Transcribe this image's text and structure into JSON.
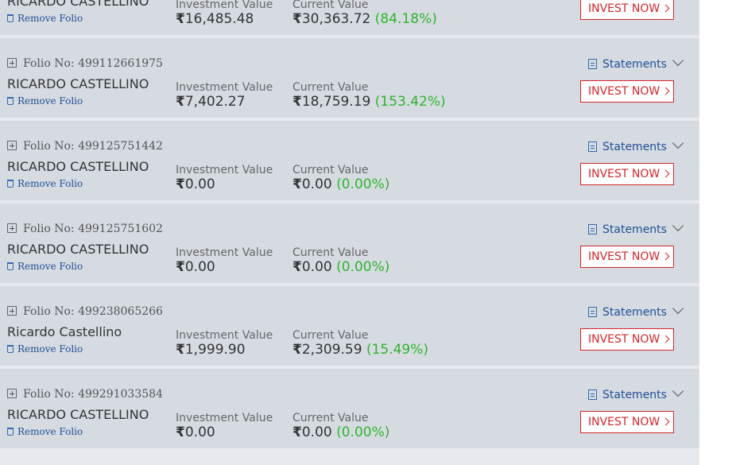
{
  "labels": {
    "investment_value": "Investment Value",
    "current_value": "Current Value",
    "remove_folio": "Remove Folio",
    "statements": "Statements",
    "invest_now": "INVEST NOW",
    "folio_prefix": "Folio No: "
  },
  "currency_symbol": "₹",
  "colors": {
    "accent_red": "#d6252b",
    "link_blue": "#1f4f93",
    "gain_green": "#2db52d",
    "card_bg": "#d6dbe2"
  },
  "icons": {
    "expand": "plus-box-icon",
    "remove": "trash-icon",
    "statements": "document-icon",
    "dropdown": "chevron-down-icon",
    "invest": "chevron-right-icon"
  },
  "folios": [
    {
      "folio_no": "",
      "holder": "RICARDO CASTELLINO",
      "investment_value": "16,485.48",
      "current_value": "30,363.72",
      "change_pct": "(84.18%)"
    },
    {
      "folio_no": "499112661975",
      "holder": "RICARDO CASTELLINO",
      "investment_value": "7,402.27",
      "current_value": "18,759.19",
      "change_pct": "(153.42%)"
    },
    {
      "folio_no": "499125751442",
      "holder": "RICARDO CASTELLINO",
      "investment_value": "0.00",
      "current_value": "0.00",
      "change_pct": "(0.00%)"
    },
    {
      "folio_no": "499125751602",
      "holder": "RICARDO CASTELLINO",
      "investment_value": "0.00",
      "current_value": "0.00",
      "change_pct": "(0.00%)"
    },
    {
      "folio_no": "499238065266",
      "holder": "Ricardo Castellino",
      "investment_value": "1,999.90",
      "current_value": "2,309.59",
      "change_pct": "(15.49%)"
    },
    {
      "folio_no": "499291033584",
      "holder": "RICARDO CASTELLINO",
      "investment_value": "0.00",
      "current_value": "0.00",
      "change_pct": "(0.00%)"
    }
  ]
}
